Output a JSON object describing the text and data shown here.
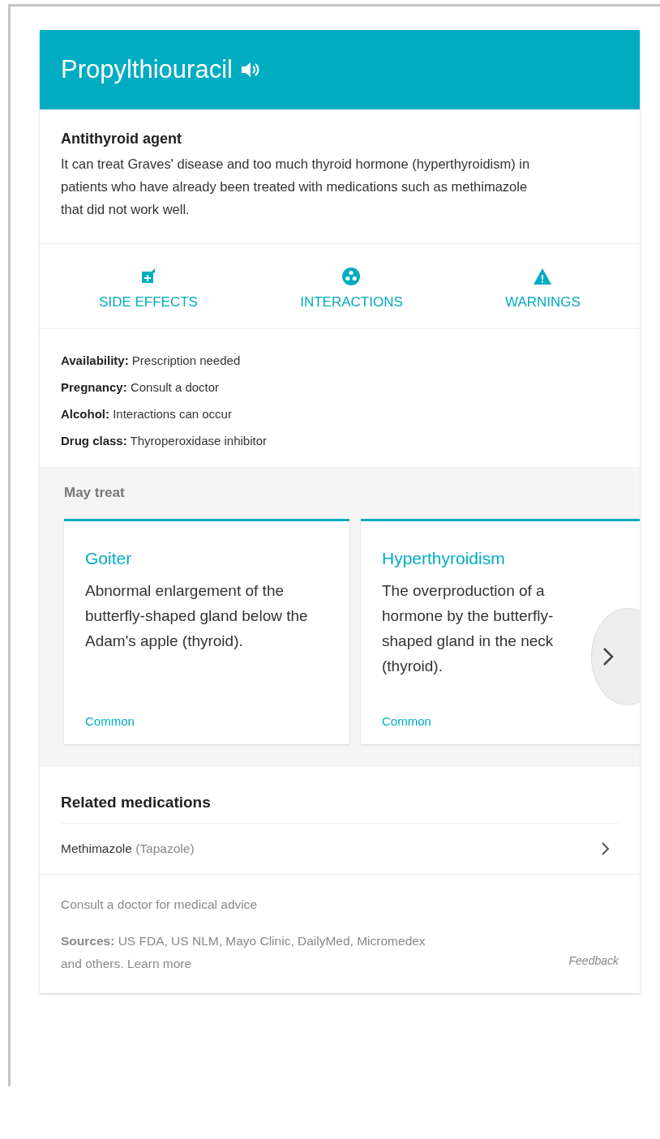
{
  "header": {
    "title": "Propylthiouracil"
  },
  "summary": {
    "heading": "Antithyroid agent",
    "text": "It can treat Graves' disease and too much thyroid hormone (hyperthyroidism) in patients who have already been treated with medications such as methimazole that did not work well."
  },
  "actions": [
    {
      "label": "SIDE EFFECTS",
      "kind": "side-effects"
    },
    {
      "label": "INTERACTIONS",
      "kind": "interactions"
    },
    {
      "label": "WARNINGS",
      "kind": "warnings"
    }
  ],
  "facts": [
    {
      "label": "Availability:",
      "value": "Prescription needed"
    },
    {
      "label": "Pregnancy:",
      "value": "Consult a doctor"
    },
    {
      "label": "Alcohol:",
      "value": "Interactions can occur"
    },
    {
      "label": "Drug class:",
      "value": "Thyroperoxidase inhibitor"
    }
  ],
  "may_treat": {
    "heading": "May treat",
    "conditions": [
      {
        "name": "Goiter",
        "description": "Abnormal enlargement of the butterfly-shaped gland below the Adam's apple (thyroid).",
        "frequency": "Common"
      },
      {
        "name": "Hyperthyroidism",
        "description": "The overproduction of a hormone by the butterfly-shaped gland in the neck (thyroid).",
        "frequency": "Common"
      }
    ]
  },
  "related": {
    "heading": "Related medications",
    "items": [
      {
        "name": "Methimazole",
        "brand": "(Tapazole)"
      }
    ]
  },
  "footer": {
    "disclaimer": "Consult a doctor for medical advice",
    "sources": "**Sources:** US FDA, US NLM, Mayo Clinic, DailyMed, Micromedex and others.",
    "link": "Learn more",
    "feedback": "Feedback"
  }
}
